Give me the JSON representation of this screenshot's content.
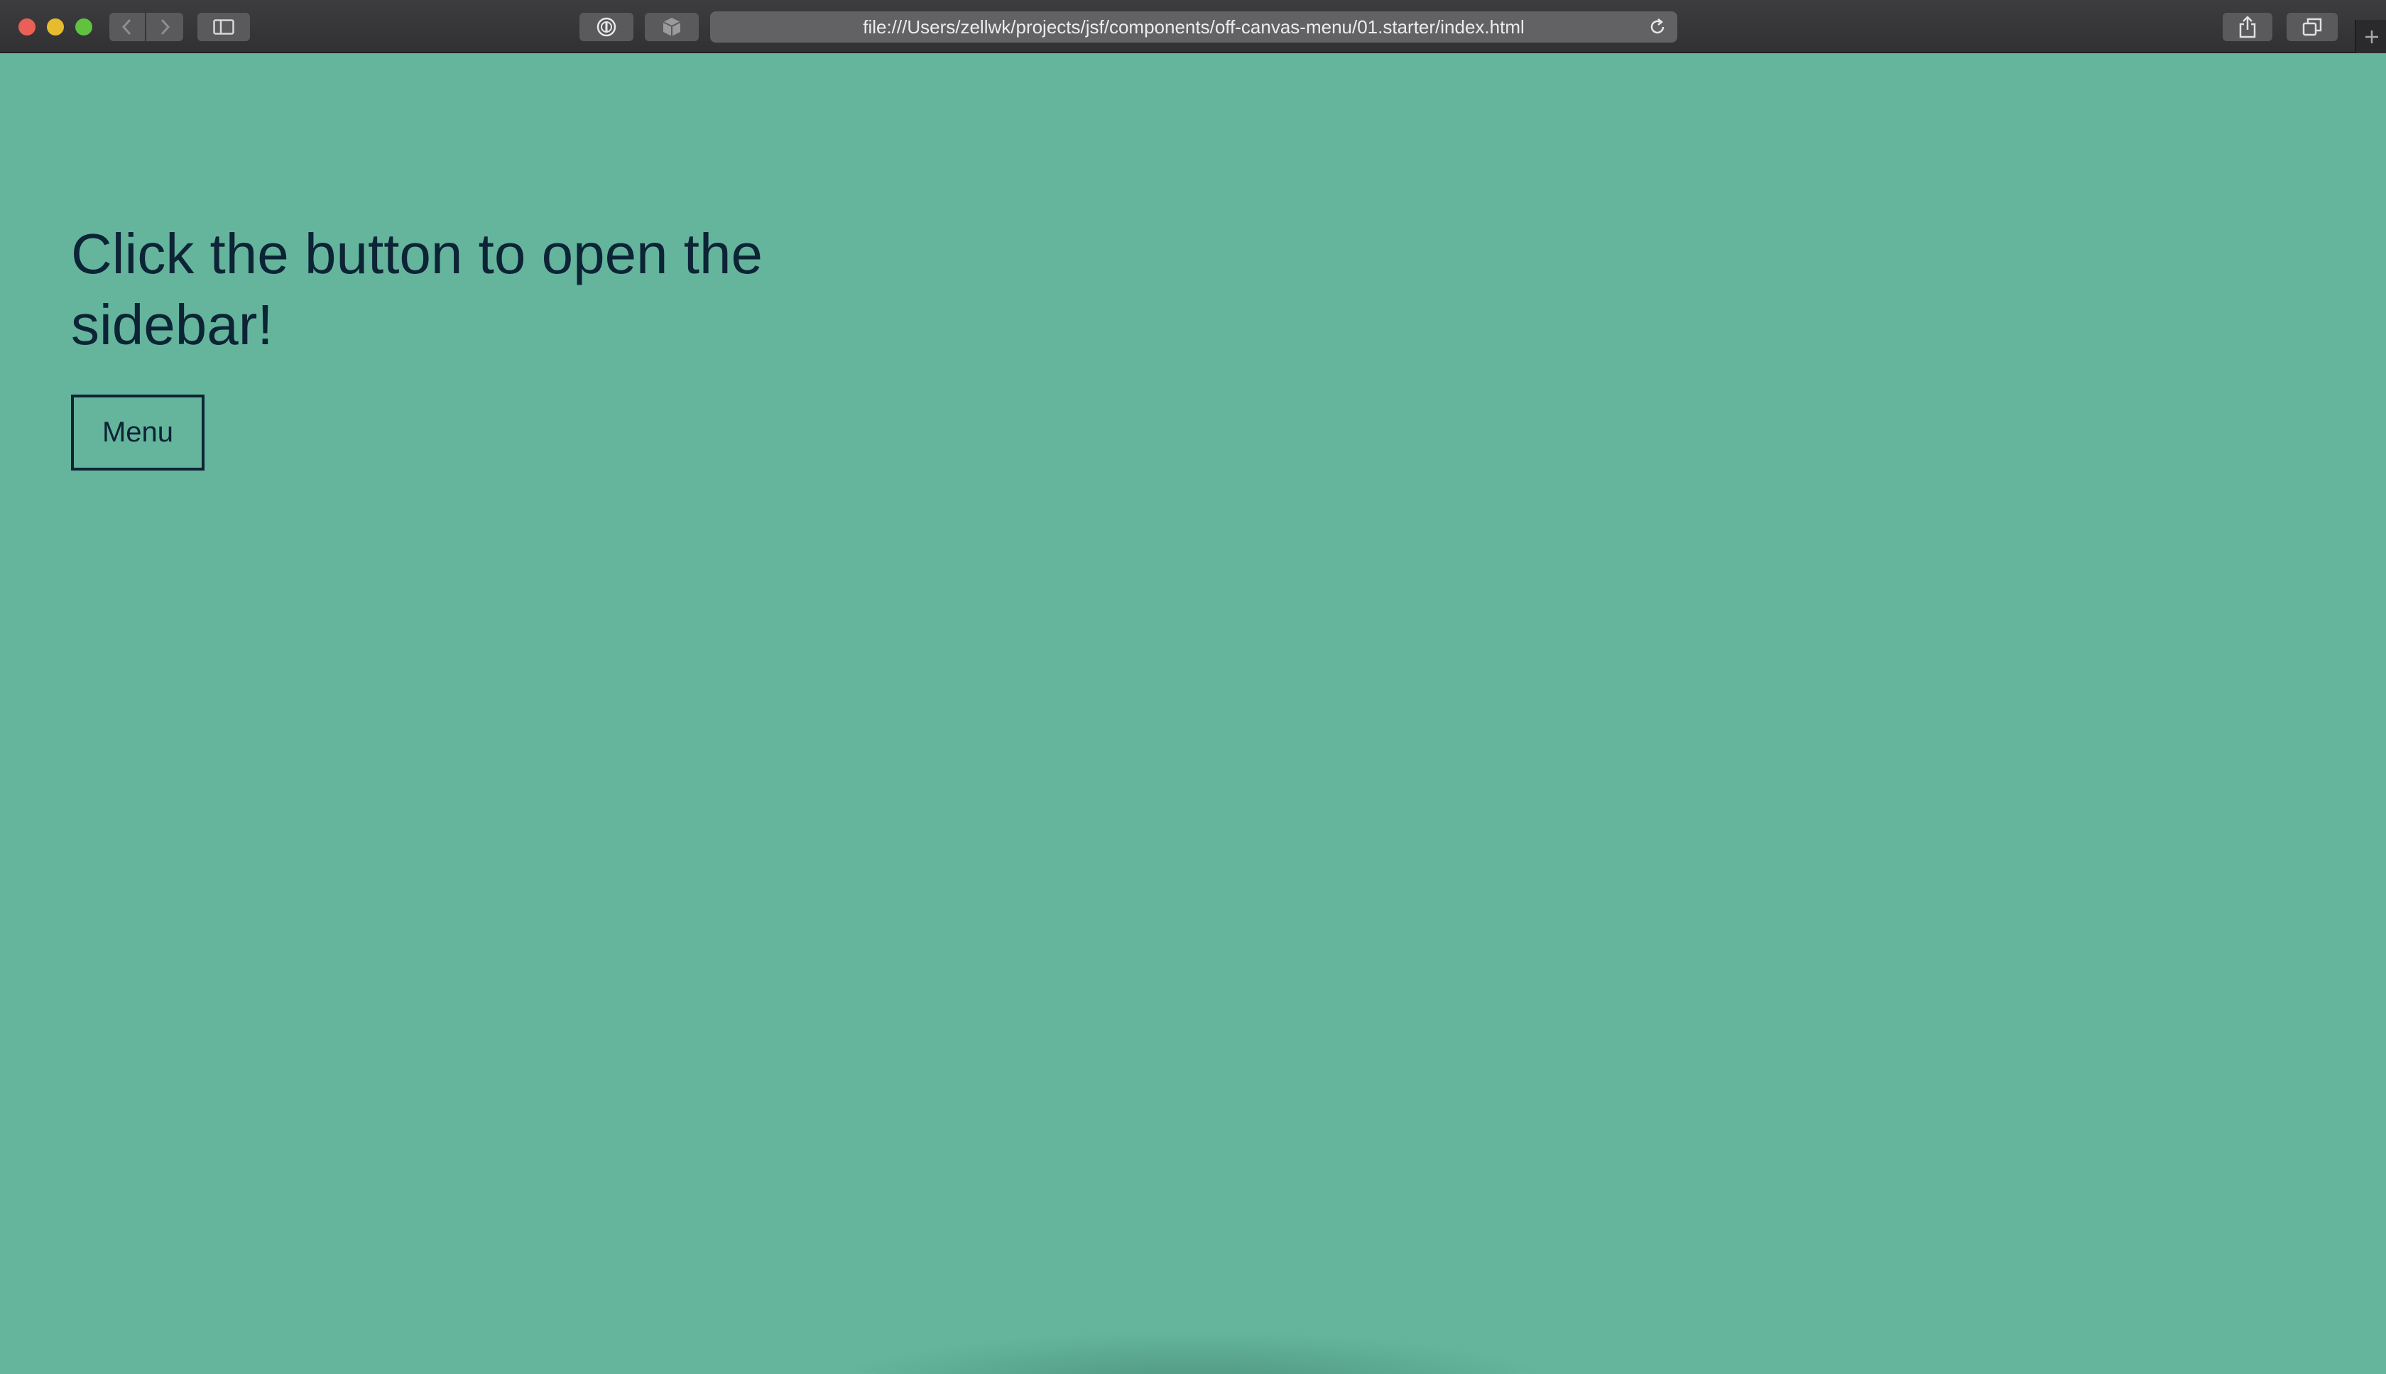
{
  "browser": {
    "address": "file:///Users/zellwk/projects/jsf/components/off-canvas-menu/01.starter/index.html",
    "icons": {
      "back": "chevron-left-icon",
      "forward": "chevron-right-icon",
      "sidebar": "sidebar-icon",
      "password": "password-manager-icon",
      "extension": "cube-icon",
      "reload": "reload-icon",
      "share": "share-icon",
      "tabs": "tab-overview-icon",
      "new_tab": "plus-icon"
    }
  },
  "page": {
    "heading": "Click the button to open the sidebar!",
    "menu_button": "Menu",
    "background_color": "#64b59c",
    "text_color": "#0d2336"
  }
}
